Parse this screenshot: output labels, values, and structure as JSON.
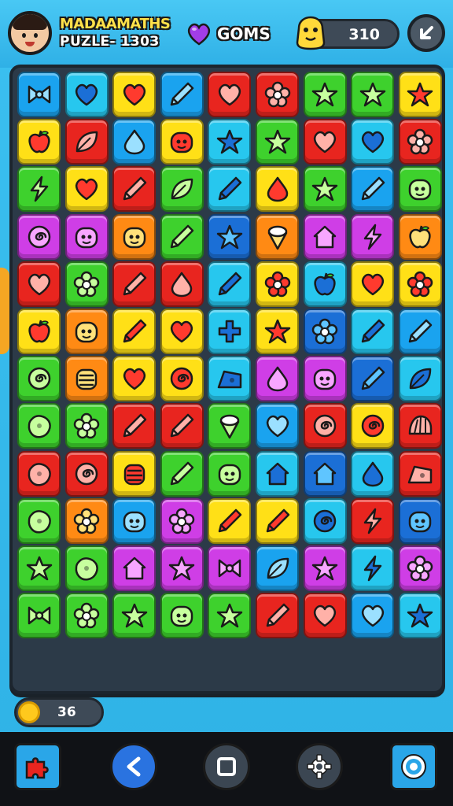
{
  "header": {
    "title_line1": "MADAAMATHS",
    "title_line2": "PUZLE- 1303",
    "gems_label": "GOMS",
    "score": "310"
  },
  "coins": {
    "value": "36"
  },
  "colors": {
    "red": "#e8251f",
    "green": "#3ed12d",
    "blue": "#1aa3ef",
    "yellow": "#ffe017",
    "cyan": "#27c7ee",
    "purple": "#cf3ee6",
    "orange": "#ff8a14",
    "navy": "#1b6fd6"
  },
  "board": {
    "rows": [
      [
        [
          "blue",
          "bow"
        ],
        [
          "cyan",
          "heart"
        ],
        [
          "yellow",
          "heart"
        ],
        [
          "blue",
          "pencil"
        ],
        [
          "red",
          "heart"
        ],
        [
          "red",
          "flower"
        ],
        [
          "green",
          "star"
        ],
        [
          "green",
          "star"
        ],
        [
          "yellow",
          "star"
        ]
      ],
      [
        [
          "yellow",
          "apple"
        ],
        [
          "red",
          "leaf"
        ],
        [
          "blue",
          "drop"
        ],
        [
          "yellow",
          "face"
        ],
        [
          "cyan",
          "star"
        ],
        [
          "green",
          "star"
        ],
        [
          "red",
          "heart"
        ],
        [
          "cyan",
          "heart"
        ],
        [
          "red",
          "flower"
        ]
      ],
      [
        [
          "green",
          "bolt"
        ],
        [
          "yellow",
          "heart"
        ],
        [
          "red",
          "pencil"
        ],
        [
          "green",
          "leaf"
        ],
        [
          "cyan",
          "pencil"
        ],
        [
          "yellow",
          "drop"
        ],
        [
          "green",
          "star"
        ],
        [
          "blue",
          "pencil"
        ],
        [
          "green",
          "face"
        ]
      ],
      [
        [
          "purple",
          "swirl"
        ],
        [
          "purple",
          "face"
        ],
        [
          "orange",
          "face"
        ],
        [
          "green",
          "pencil"
        ],
        [
          "navy",
          "star"
        ],
        [
          "orange",
          "cone"
        ],
        [
          "purple",
          "house"
        ],
        [
          "purple",
          "bolt"
        ],
        [
          "orange",
          "apple"
        ]
      ],
      [
        [
          "red",
          "heart"
        ],
        [
          "green",
          "flower"
        ],
        [
          "red",
          "pencil"
        ],
        [
          "red",
          "drop"
        ],
        [
          "cyan",
          "pencil"
        ],
        [
          "yellow",
          "flower"
        ],
        [
          "cyan",
          "apple"
        ],
        [
          "yellow",
          "heart"
        ],
        [
          "yellow",
          "flower"
        ]
      ],
      [
        [
          "yellow",
          "apple"
        ],
        [
          "orange",
          "face"
        ],
        [
          "yellow",
          "pencil"
        ],
        [
          "yellow",
          "heart"
        ],
        [
          "cyan",
          "cross"
        ],
        [
          "yellow",
          "star"
        ],
        [
          "navy",
          "flower"
        ],
        [
          "cyan",
          "pencil"
        ],
        [
          "blue",
          "pencil"
        ]
      ],
      [
        [
          "green",
          "swirl"
        ],
        [
          "orange",
          "stripes"
        ],
        [
          "yellow",
          "heart"
        ],
        [
          "yellow",
          "swirl"
        ],
        [
          "cyan",
          "cheese"
        ],
        [
          "purple",
          "drop"
        ],
        [
          "purple",
          "face"
        ],
        [
          "navy",
          "pencil"
        ],
        [
          "cyan",
          "leaf"
        ]
      ],
      [
        [
          "green",
          "blob"
        ],
        [
          "green",
          "flower"
        ],
        [
          "red",
          "pencil"
        ],
        [
          "red",
          "pencil"
        ],
        [
          "green",
          "cone"
        ],
        [
          "blue",
          "heart"
        ],
        [
          "red",
          "swirl"
        ],
        [
          "yellow",
          "swirl"
        ],
        [
          "red",
          "shell"
        ]
      ],
      [
        [
          "red",
          "blob"
        ],
        [
          "red",
          "swirl"
        ],
        [
          "yellow",
          "stripes"
        ],
        [
          "green",
          "pencil"
        ],
        [
          "green",
          "face"
        ],
        [
          "cyan",
          "house"
        ],
        [
          "navy",
          "house"
        ],
        [
          "cyan",
          "drop"
        ],
        [
          "red",
          "cheese"
        ]
      ],
      [
        [
          "green",
          "blob"
        ],
        [
          "orange",
          "flower"
        ],
        [
          "blue",
          "face"
        ],
        [
          "purple",
          "flower"
        ],
        [
          "yellow",
          "pencil"
        ],
        [
          "yellow",
          "pencil"
        ],
        [
          "cyan",
          "swirl"
        ],
        [
          "red",
          "bolt"
        ],
        [
          "navy",
          "face"
        ]
      ],
      [
        [
          "green",
          "star"
        ],
        [
          "green",
          "blob"
        ],
        [
          "purple",
          "house"
        ],
        [
          "purple",
          "star"
        ],
        [
          "purple",
          "bow"
        ],
        [
          "blue",
          "leaf"
        ],
        [
          "purple",
          "star"
        ],
        [
          "cyan",
          "bolt"
        ],
        [
          "purple",
          "flower"
        ]
      ],
      [
        [
          "green",
          "bow"
        ],
        [
          "green",
          "flower"
        ],
        [
          "green",
          "star"
        ],
        [
          "green",
          "face"
        ],
        [
          "green",
          "star"
        ],
        [
          "red",
          "pencil"
        ],
        [
          "red",
          "heart"
        ],
        [
          "blue",
          "heart"
        ],
        [
          "cyan",
          "star"
        ]
      ]
    ]
  },
  "nav": [
    {
      "icon": "puzzle-icon",
      "style": "square"
    },
    {
      "icon": "back-arrow-icon",
      "style": "round-blue"
    },
    {
      "icon": "stop-icon",
      "style": "round"
    },
    {
      "icon": "gear-icon",
      "style": "round"
    },
    {
      "icon": "target-icon",
      "style": "square"
    }
  ]
}
